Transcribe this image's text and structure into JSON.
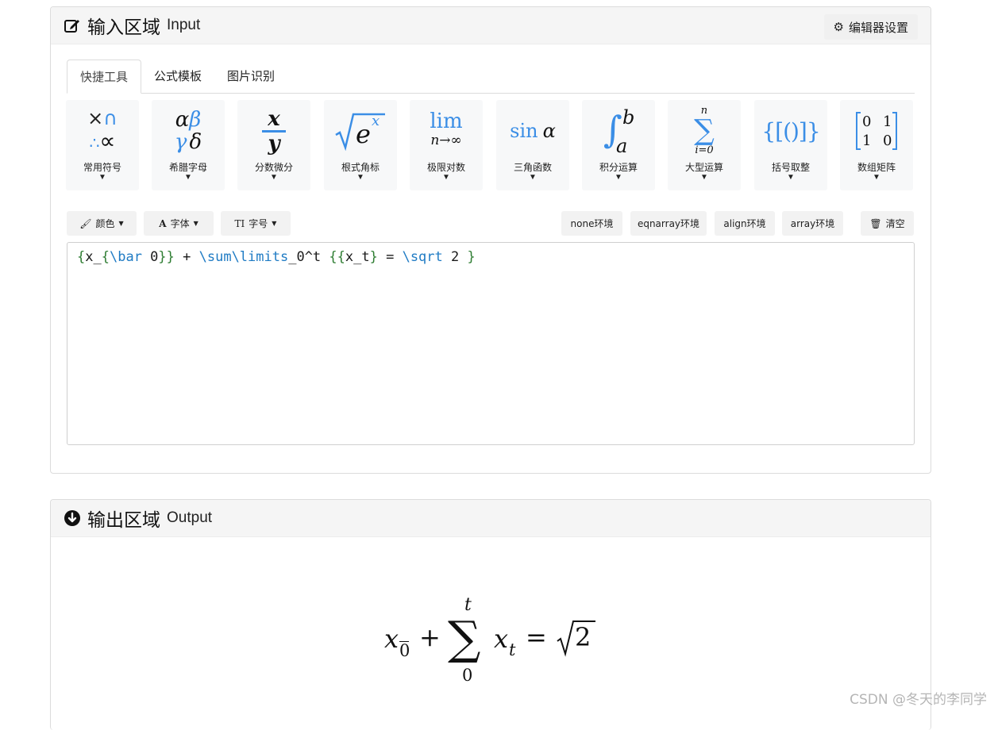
{
  "input_panel": {
    "title_cn": "输入区域",
    "title_en": "Input",
    "settings_label": "编辑器设置"
  },
  "tabs": [
    "快捷工具",
    "公式模板",
    "图片识别"
  ],
  "tools": [
    {
      "label": "常用符号",
      "icon": "symbols-icon"
    },
    {
      "label": "希腊字母",
      "icon": "greek-letters-icon"
    },
    {
      "label": "分数微分",
      "icon": "fraction-icon"
    },
    {
      "label": "根式角标",
      "icon": "radical-icon"
    },
    {
      "label": "极限对数",
      "icon": "limit-icon"
    },
    {
      "label": "三角函数",
      "icon": "trig-icon"
    },
    {
      "label": "积分运算",
      "icon": "integral-icon"
    },
    {
      "label": "大型运算",
      "icon": "sum-icon"
    },
    {
      "label": "括号取整",
      "icon": "brackets-icon"
    },
    {
      "label": "数组矩阵",
      "icon": "matrix-icon"
    }
  ],
  "glyphs": {
    "times": "×",
    "cap": "∩",
    "therefore": "∴",
    "propto": "∝",
    "alpha": "α",
    "beta": "β",
    "gamma": "γ",
    "delta": "δ",
    "frac_num": "x",
    "frac_den": "y",
    "sqrt_base": "e",
    "sqrt_exp": "x",
    "lim": "lim",
    "lim_sub": "n→∞",
    "sin": "sin",
    "sin_arg": "α",
    "int_upper": "b",
    "int_lower": "a",
    "sum_upper": "n",
    "sum_lower": "i=0",
    "brackets": "{[()]}",
    "matrix": [
      "0",
      "1",
      "1",
      "0"
    ]
  },
  "format_buttons": {
    "color": "颜色",
    "font": "字体",
    "size": "字号"
  },
  "env_buttons": [
    "none环境",
    "eqnarray环境",
    "align环境",
    "array环境"
  ],
  "clear_label": "清空",
  "editor": {
    "tokens": [
      {
        "t": "{",
        "c": "green"
      },
      {
        "t": "x_",
        "c": "dark"
      },
      {
        "t": "{",
        "c": "green"
      },
      {
        "t": "\\bar",
        "c": "blue"
      },
      {
        "t": " 0",
        "c": "dark"
      },
      {
        "t": "}}",
        "c": "green"
      },
      {
        "t": " + ",
        "c": "dark"
      },
      {
        "t": "\\sum\\limits",
        "c": "blue"
      },
      {
        "t": "_0^t ",
        "c": "dark"
      },
      {
        "t": "{{",
        "c": "green"
      },
      {
        "t": "x_t",
        "c": "dark"
      },
      {
        "t": "}",
        "c": "green"
      },
      {
        "t": " = ",
        "c": "dark"
      },
      {
        "t": "\\sqrt",
        "c": "blue"
      },
      {
        "t": " 2 ",
        "c": "dark"
      },
      {
        "t": "}",
        "c": "green"
      }
    ]
  },
  "output_panel": {
    "title_cn": "输出区域",
    "title_en": "Output"
  },
  "formula": {
    "x": "x",
    "bar_sub": "0",
    "plus": "+",
    "sum": "∑",
    "upper": "t",
    "lower": "0",
    "x2": "x",
    "sub_t": "t",
    "eq": "=",
    "radicand": "2"
  },
  "watermark": "CSDN @冬天的李同学"
}
